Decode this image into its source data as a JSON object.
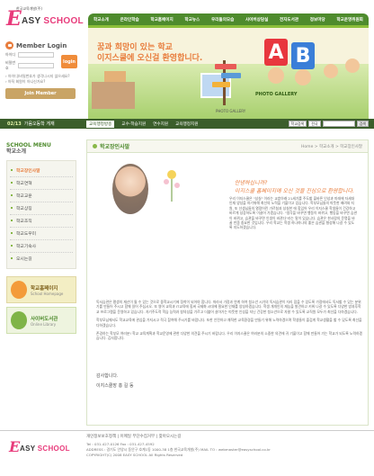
{
  "logo": {
    "tagline": "한국교육개발(주)",
    "e": "E",
    "name_pre": "ASY",
    "name_post": "SCHOOL"
  },
  "gnb": [
    "학교소개",
    "온라인학습",
    "학교홈페이지",
    "학교뉴스",
    "우리들의모습",
    "사이버상담실",
    "전자도서관",
    "정보마당",
    "학교운영위원회"
  ],
  "login": {
    "title": "Member Login",
    "id_label": "아이디",
    "pw_label": "비밀번호",
    "login_btn": "login",
    "link1": "› 아이디/비밀번호가 생각나시지 않으세요?",
    "link2": "› 아직 회원이 아니신가요?",
    "join_btn": "Join Member"
  },
  "hero": {
    "line1": "꿈과 희망이 있는 학교",
    "line2": "이지스쿨에 오신걸 환영합니다.",
    "photo_gallery": "PHOTO GALLERY",
    "photo_gallery2": "PHOTO GALLERY",
    "a": "A",
    "b": "B"
  },
  "subbar": {
    "date": "02/13",
    "date_text": "가음오동학 게재",
    "tabs": [
      "교육행정방송",
      "교수·학습지원",
      "연수지원",
      "교육행정지원"
    ],
    "search_select": "학교검색",
    "search_select2": "전국",
    "go": "검색"
  },
  "side": {
    "title1": "SCHOOL MENU",
    "title2": "학교소개",
    "items": [
      "학교장인사말",
      "학교연혁",
      "학교교훈",
      "학교상징",
      "학교조직",
      "학교도우미",
      "학교기숙사",
      "오시는길"
    ],
    "banner1_title": "학교홈페이지",
    "banner1_sub": "School Homepage",
    "banner2_title": "사이버도서관",
    "banner2_sub": "Online Library"
  },
  "content": {
    "title": "학교장인사말",
    "breadcrumb": "Home > 학교소개 > 학교장인사말",
    "greet1": "안녕하십니까?",
    "greet2": "이지스쿨 홈페이지에 오신 것을 진심으로 환영합니다.",
    "intro": "우리 이지스쿨은 \"성실\" 이라는 교훈아래 21세기를 주도할 올바른 인성과 미래에 자세대 인재 양성을 하기위해 최선의 노력을 기울이고 있습니다. 학부모님들의 따뜻한 배려와 지원, 또 선생님들의 열정어린 가르침과 성실한 애 힘입어 우리 이지스쿨 학생들이 건강하고 바르게 성장하도록 이끌어 가겠습니다. \"생각을 바꾸면 행동이 바뀌고, 행동을 바꾸면 습관이 바뀌고, 습관을 바꾸면 인생이 바뀐다\"라는 말이 있습니다. 습관은 한사람의 운명을 바꿀 만큼 중요한 것입니다. 우리 학교는 학생 하나하나의 좋은 습관을 형성해 나갈 수 있도록 지도하겠습니다.",
    "body1": "독서습관은 평생의 재산이 될 수 있는 것으로 중학교시기에 정착이 되어야 합니다. 따라서 가정과 연계 하여 청소년 시기의 독서습관이 자리 잡을 수 있도록 가정에서도 독서할 수 있는 분위기를 만들어 주시고 함께 읽어 주십시오. 또 영어 교육과 IT교육에 힘써 국제화 시대에 필요한 인재를 양성하겠습니다. 학생 개개인의 재능을 발견하고 키워 나갈 수 있도록 다양한 방과후학교 프로그램을 운영하고 있습니다. 자기주도적 학습 능력과 창의성을 기르고 더불어 살아가는 따뜻한 인성을 지닌 건강한 청소년으로 자랄 수 있도록 교직원 모두가 최선을 다하겠습니다.",
    "body2": "학부모님께서도 학교교육에 관심을 가지시고 적극 참여해 주시기를 바랍니다. 또한 안전하고 쾌적한 교육환경을 만들기 위해 노력하겠으며 학생들이 즐겁게 학교생활을 할 수 있도록 최선을 다하겠습니다.",
    "body3": "존경하는 학부모 여러분! 학교 교육계획과 학교운영에 관한 다양한 의견을 주시기 바랍니다. 우리 이지스쿨은 여러분의 소중한 의견에 귀 기울이고 함께 만들어 가는 학교가 되도록 노력하겠습니다. 감사합니다.",
    "sig1": "감사합니다.",
    "sig2": "이지스쿨장 홍 길 동"
  },
  "footer": {
    "links": "개인정보보호정책 | 이메일 무단수집거부 | 찾아오시는길",
    "line1": "Tel : 031-427-0126  Fax : 031-427-4592",
    "line2": "ADDRESS : 경기도 안양시 동안구 호계1동 1000-38 1층 한국교육개발(주)  MAIL TO : webmaster@easyschool.co.kr",
    "line3": "COPYRIGHT(C) 2008 EASY SCHOOL All Rights Reserved"
  }
}
